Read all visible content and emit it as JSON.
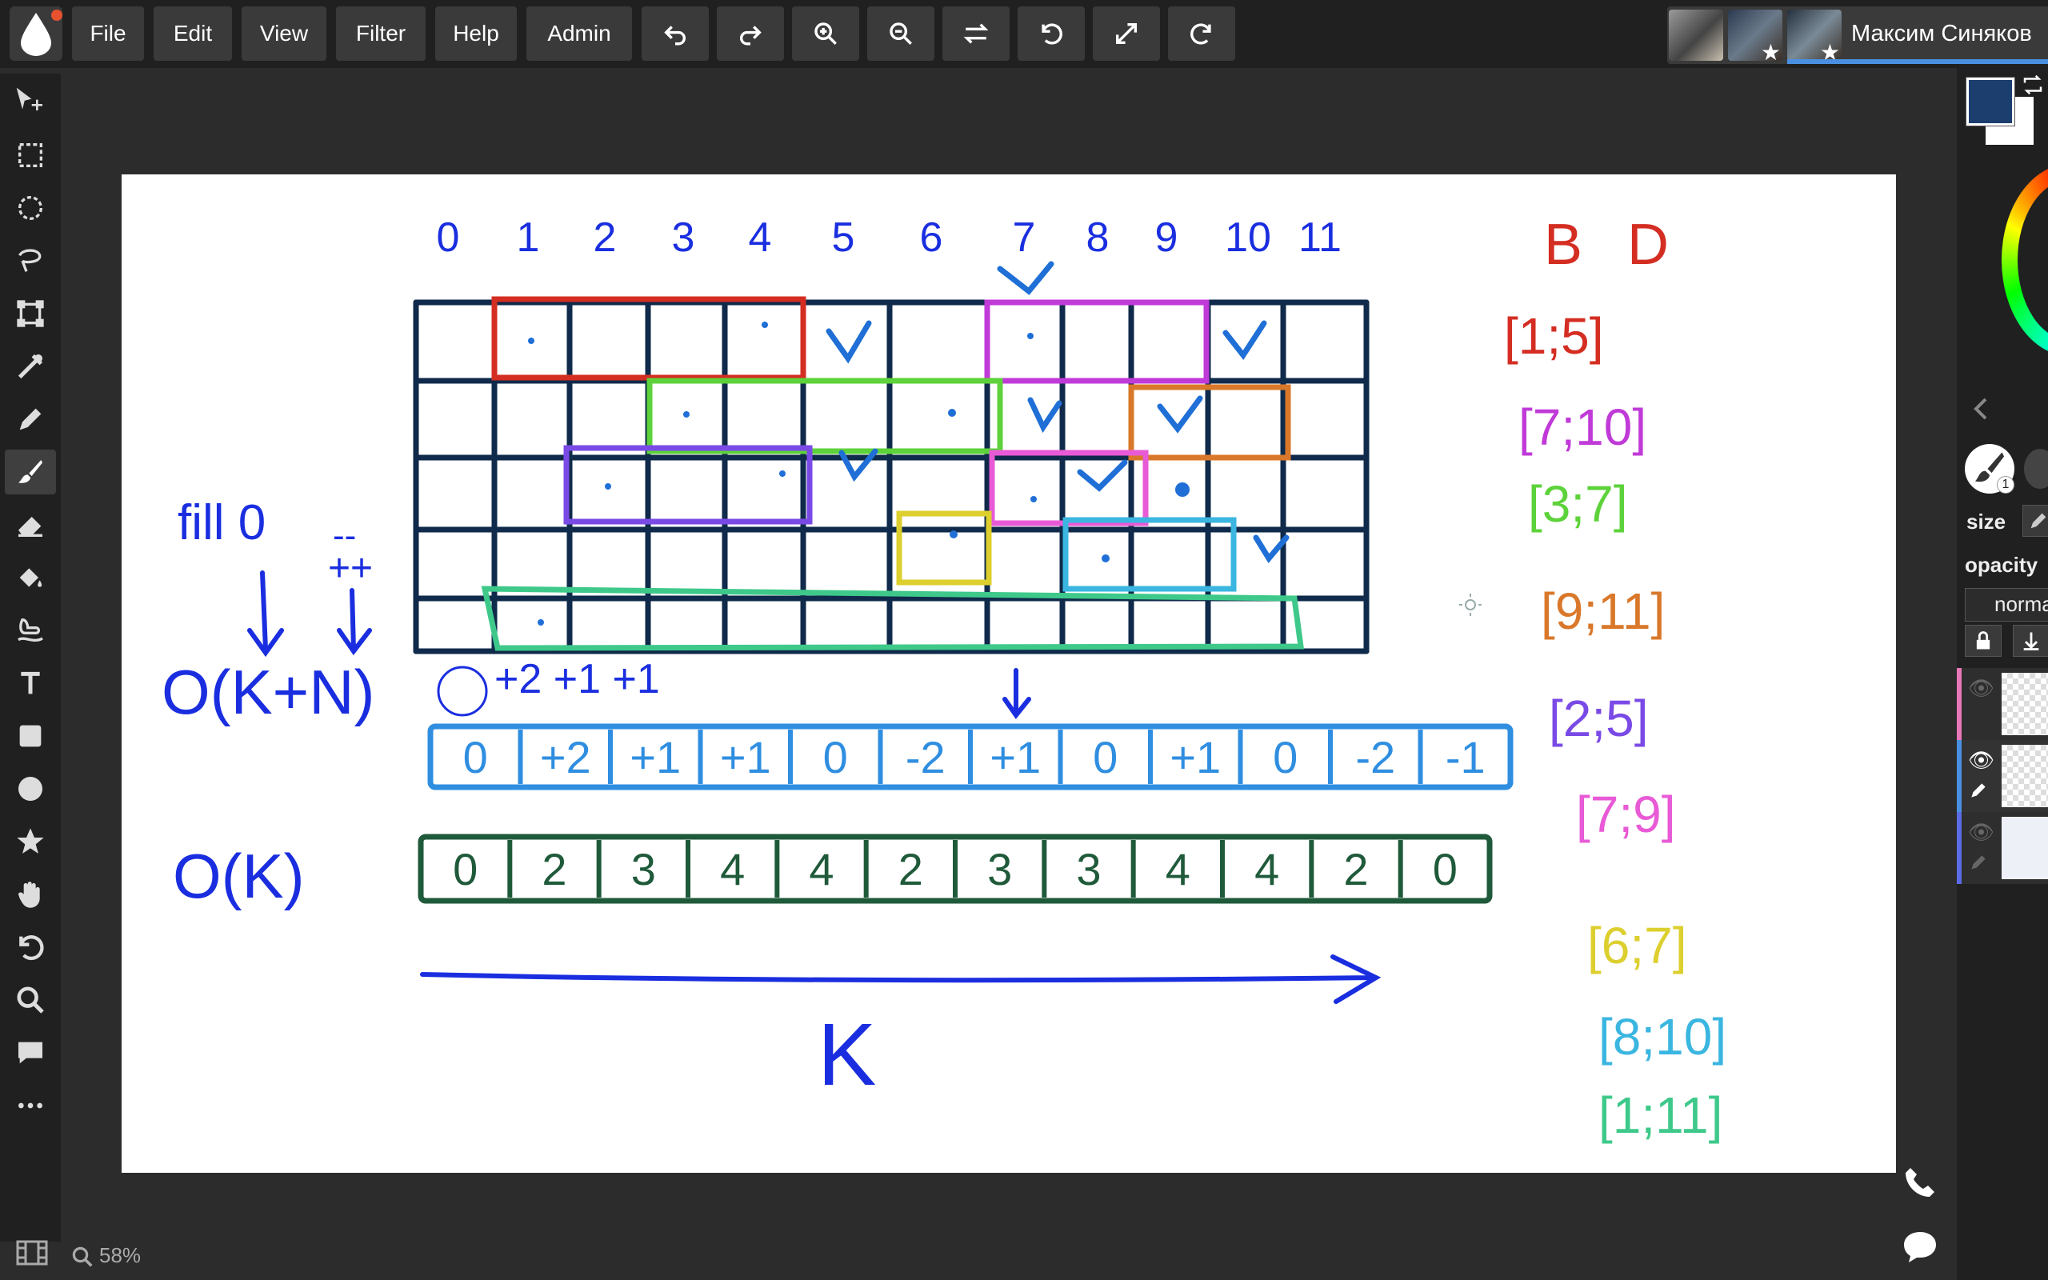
{
  "menubar": {
    "items": [
      {
        "label": "File",
        "name": "file"
      },
      {
        "label": "Edit",
        "name": "edit"
      },
      {
        "label": "View",
        "name": "view"
      },
      {
        "label": "Filter",
        "name": "filter"
      },
      {
        "label": "Help",
        "name": "help"
      },
      {
        "label": "Admin",
        "name": "admin"
      }
    ],
    "actions": [
      "undo-icon",
      "redo-icon",
      "zoom-in-icon",
      "zoom-out-icon",
      "flip-icon",
      "rotate-left-icon",
      "fullscreen-icon",
      "rotate-right-icon"
    ]
  },
  "user": {
    "name": "Максим Синяков",
    "avatar_count": 3
  },
  "tools": [
    "move-icon",
    "rect-select-icon",
    "ellipse-select-icon",
    "lasso-icon",
    "transform-icon",
    "eyedropper-icon",
    "pencil-icon",
    "brush-icon",
    "eraser-icon",
    "bucket-icon",
    "smudge-icon",
    "text-icon",
    "rectangle-icon",
    "ellipse-icon",
    "shape-icon",
    "hand-icon",
    "rotate-view-icon",
    "zoom-icon",
    "comment-icon",
    "more-icon"
  ],
  "status": {
    "zoom": "58%"
  },
  "brush_panel": {
    "brush_number": "1",
    "size_label": "size",
    "opacity_label": "opacity",
    "blend_mode": "norma"
  },
  "colors": {
    "foreground": "#1c3e6e",
    "background": "#ffffff",
    "accent": "#4a90e2",
    "ink_blue": "#1a2ee0",
    "grid_navy": "#0f2a4a"
  },
  "drawing": {
    "column_numbers": [
      "0",
      "1",
      "2",
      "3",
      "4",
      "5",
      "6",
      "7",
      "8",
      "9",
      "10",
      "11"
    ],
    "header": {
      "b": "B",
      "d": "D"
    },
    "intervals": [
      {
        "text": "[1;5]",
        "color": "#d42d22"
      },
      {
        "text": "[7;10]",
        "color": "#c03ad8"
      },
      {
        "text": "[3;7]",
        "color": "#5dd23a"
      },
      {
        "text": "[9;11]",
        "color": "#d9782a"
      },
      {
        "text": "[2;5]",
        "color": "#7a4ae6"
      },
      {
        "text": "[7;9]",
        "color": "#e85ad6"
      },
      {
        "text": "[6;7]",
        "color": "#dccf2e"
      },
      {
        "text": "[8;10]",
        "color": "#3ab6e0"
      },
      {
        "text": "[1;11]",
        "color": "#3ec98a"
      }
    ],
    "fill_note": "fill 0",
    "dec_mark": "--",
    "inc_mark": "++",
    "complexity_1": "O(K+N)",
    "complexity_2": "O(K)",
    "delta_label": "+2 +1 +1",
    "diff_values": [
      "0",
      "+2",
      "+1",
      "+1",
      "0",
      "-2",
      "+1",
      "0",
      "+1",
      "0",
      "-2",
      "-1"
    ],
    "prefix_values": [
      "0",
      "2",
      "3",
      "4",
      "4",
      "2",
      "3",
      "3",
      "4",
      "4",
      "2",
      "0"
    ],
    "axis_label": "K"
  }
}
